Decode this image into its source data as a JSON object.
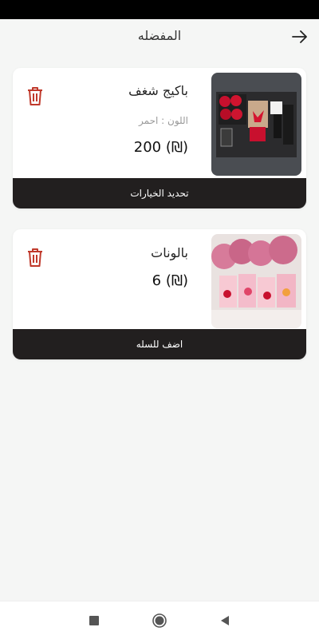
{
  "app_bar": {
    "title": "المفضله"
  },
  "favorites": [
    {
      "name": "باكيج شغف",
      "color_label": "اللون : احمر",
      "price": "200 (₪)",
      "action_label": "تحديد الخيارات"
    },
    {
      "name": "بالونات",
      "price": "6 (₪)",
      "action_label": "اضف للسله"
    }
  ],
  "colors": {
    "accent_red": "#c0392b",
    "action_bar": "#221f1f"
  },
  "icons": {
    "back": "arrow-right-icon",
    "delete": "trash-icon",
    "nav": [
      "square-icon",
      "circle-home-icon",
      "triangle-back-icon"
    ]
  }
}
